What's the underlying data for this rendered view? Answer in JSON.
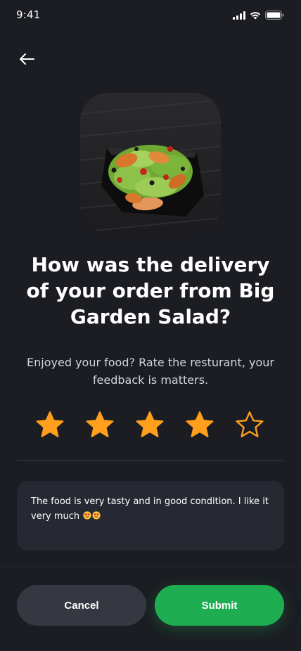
{
  "status_bar": {
    "time": "9:41",
    "icons": [
      "signal-icon",
      "wifi-icon",
      "battery-icon"
    ]
  },
  "header": {
    "back_icon": "arrow-left-icon"
  },
  "food_image": {
    "subject": "salad-bowl-photo"
  },
  "title": "How was the delivery of your order from Big Garden Salad?",
  "subtitle": "Enjoyed your food? Rate the resturant, your feedback is matters.",
  "rating": {
    "value": 4,
    "max": 5,
    "filled_color": "#ff9f1c",
    "empty_color": "#ff9f1c"
  },
  "feedback": {
    "text": "The food is very tasty and in good condition. I like it very much",
    "emojis": [
      "heart-eyes-emoji",
      "heart-eyes-emoji"
    ]
  },
  "buttons": {
    "cancel_label": "Cancel",
    "submit_label": "Submit"
  },
  "colors": {
    "background": "#1b1d22",
    "accent": "#1fad52",
    "star": "#ff9f1c"
  }
}
